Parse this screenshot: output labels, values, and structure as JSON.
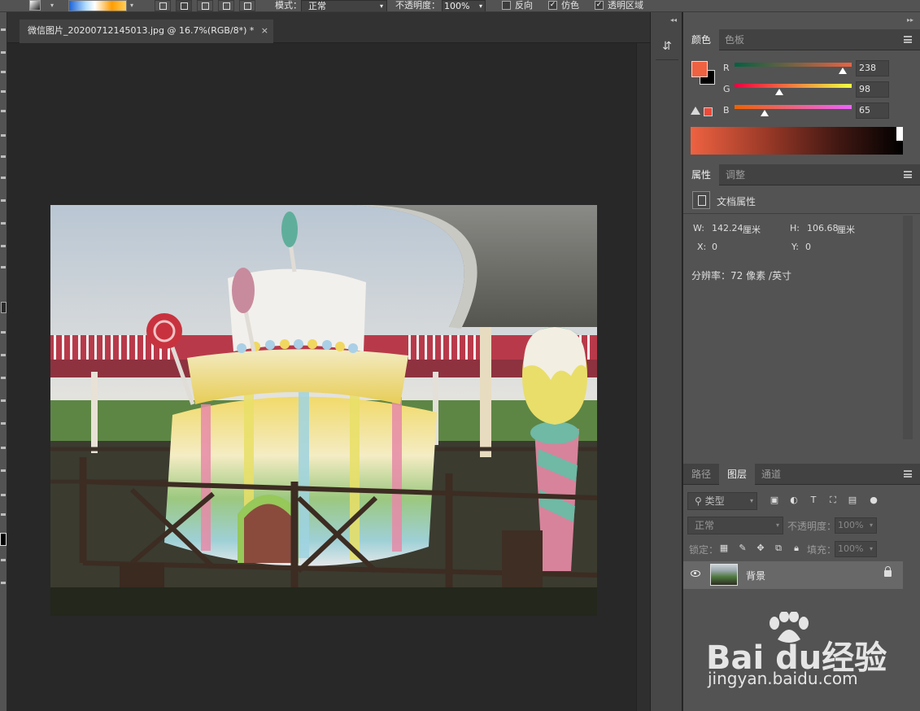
{
  "options_bar": {
    "mode_label": "模式：",
    "mode_value": "正常",
    "opacity_label": "不透明度：",
    "opacity_value": "100%",
    "reverse_label": "反向",
    "dither_label": "仿色",
    "transparency_label": "透明区域",
    "reverse_checked": false,
    "dither_checked": true,
    "transparency_checked": true
  },
  "document": {
    "tab_title": "微信图片_20200712145013.jpg @ 16.7%(RGB/8*) *",
    "close_glyph": "×"
  },
  "color_panel": {
    "tabs": [
      {
        "label": "颜色",
        "active": true
      },
      {
        "label": "色板",
        "active": false
      }
    ],
    "foreground_color": "#ee6241",
    "background_color": "#000000",
    "channels": [
      {
        "label": "R",
        "value": "238"
      },
      {
        "label": "G",
        "value": "98"
      },
      {
        "label": "B",
        "value": "65"
      }
    ]
  },
  "properties_panel": {
    "tabs": [
      {
        "label": "属性",
        "active": true
      },
      {
        "label": "调整",
        "active": false
      }
    ],
    "section_title": "文档属性",
    "w_label": "W:",
    "w_value": "142.24",
    "w_unit": "厘米",
    "h_label": "H:",
    "h_value": "106.68",
    "h_unit": "厘米",
    "x_label": "X:",
    "x_value": "0",
    "y_label": "Y:",
    "y_value": "0",
    "resolution": "分辨率：72 像素 /英寸"
  },
  "layers_panel": {
    "tabs": [
      {
        "label": "路径",
        "active": false
      },
      {
        "label": "图层",
        "active": true
      },
      {
        "label": "通道",
        "active": false
      }
    ],
    "filter_label": "类型",
    "blend_mode": "正常",
    "opacity_label": "不透明度：",
    "opacity_value": "100%",
    "lock_label": "锁定：",
    "fill_label": "填充：",
    "fill_value": "100%",
    "layers": [
      {
        "name": "背景",
        "visible": true,
        "locked": true
      }
    ]
  },
  "watermark": {
    "brand": "Bai  du经验",
    "url": "jingyan.baidu.com"
  }
}
